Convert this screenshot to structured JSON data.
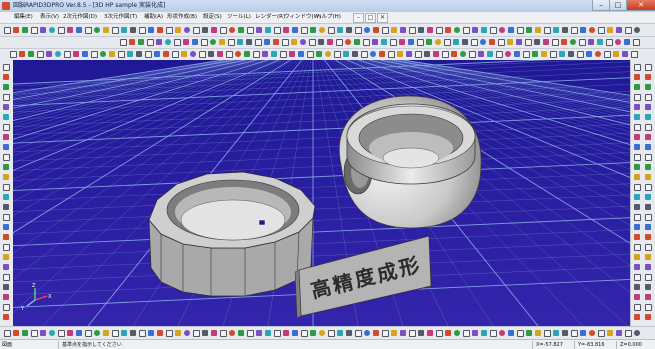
{
  "window": {
    "title": "図脳RAPID3DPRO Ver.8.5 - [3D HP sample 実装化成]",
    "controls": {
      "minimize": "–",
      "maximize": "□",
      "close": "✕"
    }
  },
  "menu": {
    "items": [
      "編集(E)",
      "表示(V)",
      "2次元作図(D)",
      "3次元作図(T)",
      "補助(A)",
      "形状作成(B)",
      "設定(S)",
      "ツール(L)",
      "レンダー(R)",
      "ウィンドウ(W)",
      "ヘルプ(H)"
    ],
    "mdi_controls": {
      "minimize": "–",
      "restore": "□",
      "close": "✕"
    }
  },
  "viewport": {
    "background_color": "#2a1fa0",
    "grid_color": "#8fb2ea",
    "model_label_chars": [
      "高",
      "精",
      "度",
      "成",
      "形"
    ],
    "axis_labels": {
      "x": "X",
      "y": "Y",
      "z": "Z"
    }
  },
  "statusbar": {
    "mode": "図面",
    "message": "基準点を指示してください",
    "x": "X=-57.827",
    "y": "Y=-83.816",
    "z": "Z=0.000"
  }
}
